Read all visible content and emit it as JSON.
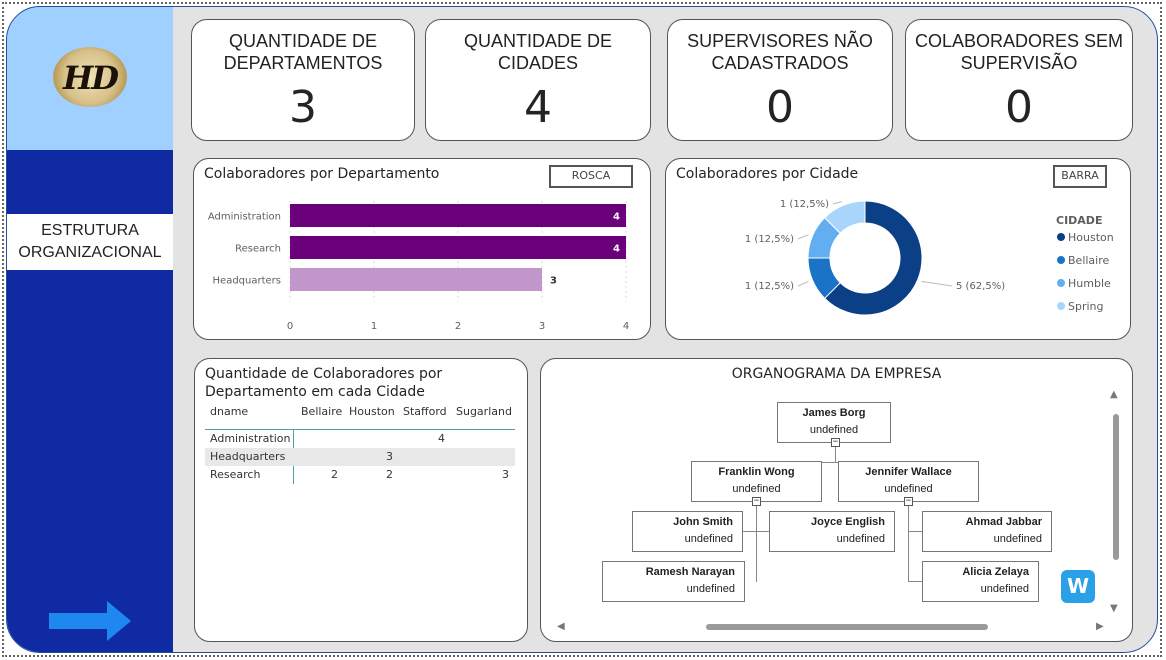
{
  "sidebar": {
    "logo_text": "HD",
    "nav_label_line1": "ESTRUTURA",
    "nav_label_line2": "ORGANIZACIONAL"
  },
  "kpis": [
    {
      "title_line1": "QUANTIDADE DE",
      "title_line2": "DEPARTAMENTOS",
      "value": "3"
    },
    {
      "title_line1": "QUANTIDADE DE",
      "title_line2": "CIDADES",
      "value": "4"
    },
    {
      "title_line1": "SUPERVISORES NÃO",
      "title_line2": "CADASTRADOS",
      "value": "0"
    },
    {
      "title_line1": "COLABORADORES SEM",
      "title_line2": "SUPERVISÃO",
      "value": "0"
    }
  ],
  "dept_chart": {
    "title": "Colaboradores por Departamento",
    "toggle_label": "ROSCA"
  },
  "city_chart": {
    "title": "Colaboradores por Cidade",
    "toggle_label": "BARRA",
    "legend_title": "CIDADE"
  },
  "chart_data": [
    {
      "type": "bar",
      "orientation": "horizontal",
      "title": "Colaboradores por Departamento",
      "categories": [
        "Administration",
        "Research",
        "Headquarters"
      ],
      "values": [
        4,
        4,
        3
      ],
      "data_labels": [
        "4",
        "4",
        "3"
      ],
      "colors": [
        "#6b007b",
        "#6b007b",
        "#c396cb"
      ],
      "xlim": [
        0,
        4
      ],
      "x_ticks": [
        "0",
        "1",
        "2",
        "3",
        "4"
      ],
      "grid": true
    },
    {
      "type": "pie",
      "style": "donut",
      "title": "Colaboradores por Cidade",
      "categories": [
        "Houston",
        "Bellaire",
        "Humble",
        "Spring"
      ],
      "values": [
        5,
        1,
        1,
        1
      ],
      "data_labels": [
        "5 (62,5%)",
        "1 (12,5%)",
        "1 (12,5%)",
        "1 (12,5%)"
      ],
      "colors": [
        "#0b3f86",
        "#1a73c7",
        "#63aef0",
        "#a9d4fb"
      ],
      "legend_title": "CIDADE",
      "legend_position": "right"
    }
  ],
  "matrix": {
    "title_line1": "Quantidade de Colaboradores por",
    "title_line2": "Departamento em cada Cidade",
    "header_row": "dname",
    "columns": [
      "Bellaire",
      "Houston",
      "Stafford",
      "Sugarland"
    ],
    "rows": [
      {
        "label": "Administration",
        "cells": [
          "",
          "",
          "4",
          ""
        ]
      },
      {
        "label": "Headquarters",
        "cells": [
          "",
          "3",
          "",
          ""
        ]
      },
      {
        "label": "Research",
        "cells": [
          "2",
          "2",
          "",
          "3"
        ]
      }
    ]
  },
  "org": {
    "title": "ORGANOGRAMA DA EMPRESA",
    "nodes": {
      "james": {
        "name": "James Borg",
        "role": "undefined"
      },
      "franklin": {
        "name": "Franklin Wong",
        "role": "undefined"
      },
      "jennifer": {
        "name": "Jennifer Wallace",
        "role": "undefined"
      },
      "john": {
        "name": "John Smith",
        "role": "undefined"
      },
      "joyce": {
        "name": "Joyce English",
        "role": "undefined"
      },
      "ramesh": {
        "name": "Ramesh Narayan",
        "role": "undefined"
      },
      "ahmad": {
        "name": "Ahmad Jabbar",
        "role": "undefined"
      },
      "alicia": {
        "name": "Alicia Zelaya",
        "role": "undefined"
      }
    },
    "collapse_glyph": "−"
  },
  "badge": {
    "text": "W"
  },
  "colors": {
    "sidebar": "#0f2aa3",
    "logo_area": "#9fd0ff",
    "arrow": "#1e88f0",
    "canvas": "#e3e3e3"
  }
}
